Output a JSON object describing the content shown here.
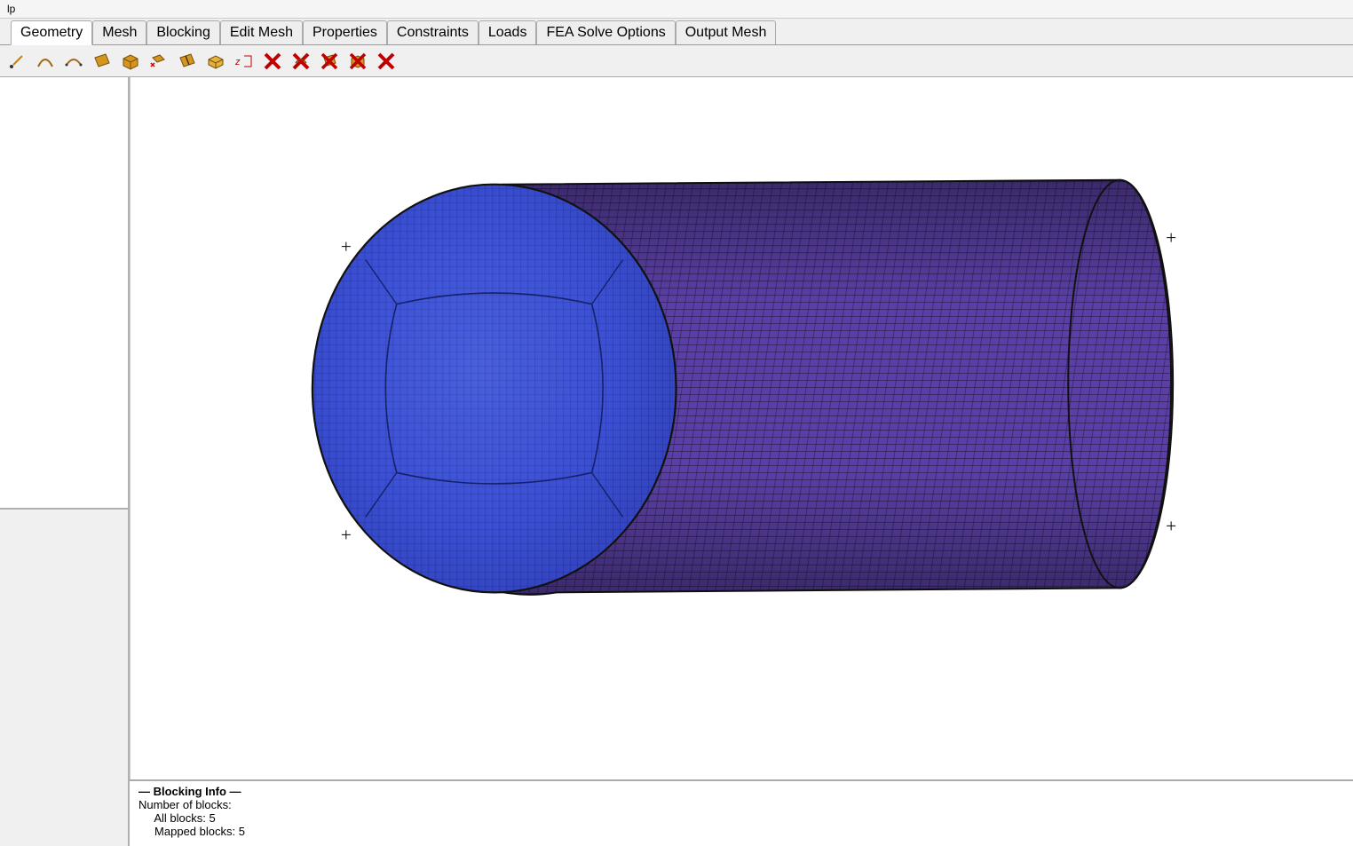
{
  "menubar": {
    "help": "lp"
  },
  "tabs": [
    {
      "label": "Geometry",
      "active": true
    },
    {
      "label": "Mesh",
      "active": false
    },
    {
      "label": "Blocking",
      "active": false
    },
    {
      "label": "Edit Mesh",
      "active": false
    },
    {
      "label": "Properties",
      "active": false
    },
    {
      "label": "Constraints",
      "active": false
    },
    {
      "label": "Loads",
      "active": false
    },
    {
      "label": "FEA Solve Options",
      "active": false
    },
    {
      "label": "Output Mesh",
      "active": false
    }
  ],
  "toolbar": {
    "icons": [
      "create-point-icon",
      "create-curve-icon",
      "create-arc-icon",
      "create-surface-icon",
      "create-body-icon",
      "transform-geometry-icon",
      "repair-geometry-icon",
      "extrude-icon",
      "split-icon",
      "delete-point-icon",
      "delete-curve-icon",
      "delete-surface-icon",
      "delete-body-icon",
      "delete-any-icon"
    ]
  },
  "log": {
    "header": "— Blocking Info —",
    "line1": "Number of blocks:",
    "line2": "     All blocks: 5",
    "line3": "     Mapped blocks: 5"
  },
  "model": {
    "description": "Structured hex mesh on a solid cylinder (O-grid face visible)",
    "colors": {
      "face": "#3a4fd6",
      "side": "#5b3fa6",
      "edge": "#1b1b40"
    }
  }
}
